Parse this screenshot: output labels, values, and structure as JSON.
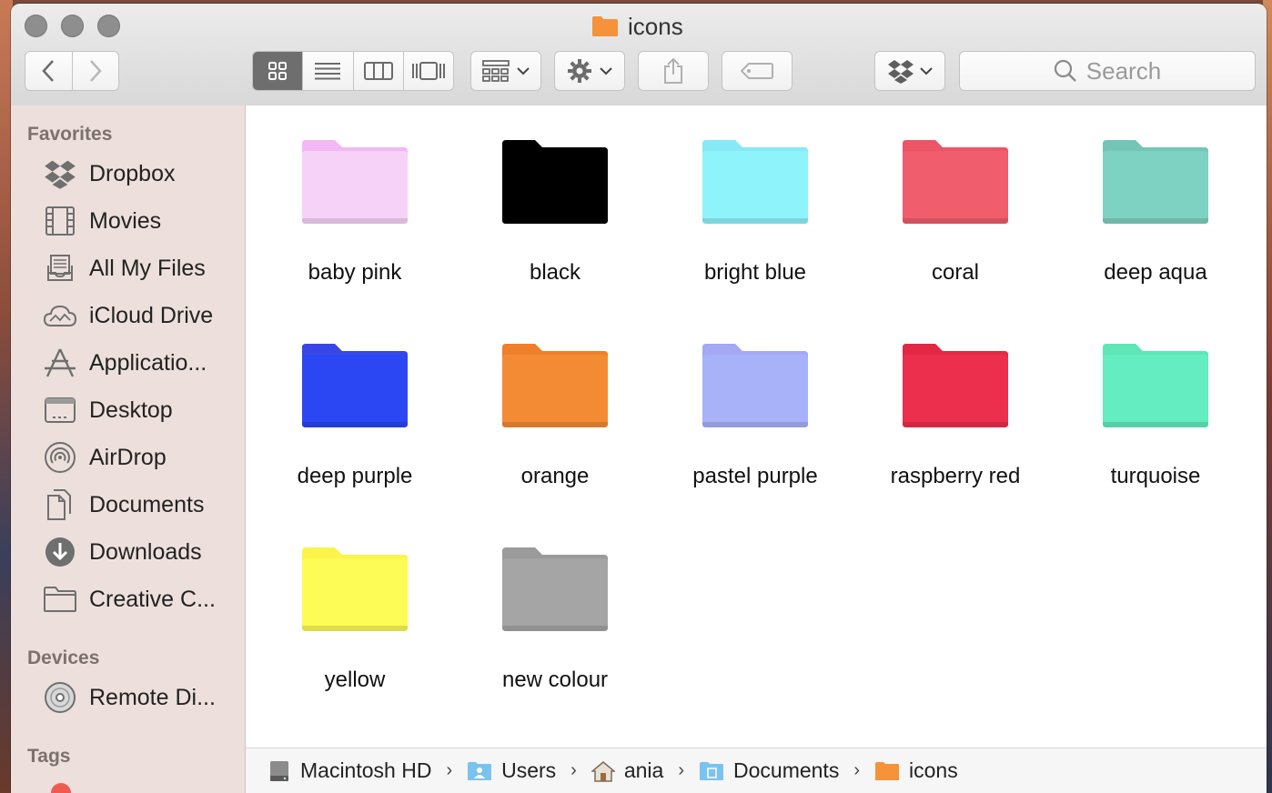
{
  "window": {
    "title": "icons"
  },
  "toolbar": {
    "search_placeholder": "Search"
  },
  "sidebar": {
    "favorites_header": "Favorites",
    "favorites": [
      {
        "label": "Dropbox",
        "icon": "dropbox-icon"
      },
      {
        "label": "Movies",
        "icon": "film-icon"
      },
      {
        "label": "All My Files",
        "icon": "all-files-icon"
      },
      {
        "label": "iCloud Drive",
        "icon": "cloud-icon"
      },
      {
        "label": "Applicatio...",
        "icon": "applications-icon"
      },
      {
        "label": "Desktop",
        "icon": "desktop-icon"
      },
      {
        "label": "AirDrop",
        "icon": "airdrop-icon"
      },
      {
        "label": "Documents",
        "icon": "documents-icon"
      },
      {
        "label": "Downloads",
        "icon": "download-icon"
      },
      {
        "label": "Creative C...",
        "icon": "folder-icon"
      }
    ],
    "devices_header": "Devices",
    "devices": [
      {
        "label": "Remote Di...",
        "icon": "disc-icon"
      }
    ],
    "tags_header": "Tags"
  },
  "folders": [
    {
      "name": "baby pink",
      "color": "#f7d2f8",
      "tab": "#f3b7f3"
    },
    {
      "name": "black",
      "color": "#000000",
      "tab": "#000000"
    },
    {
      "name": "bright blue",
      "color": "#8ff3fb",
      "tab": "#86e9f5"
    },
    {
      "name": "coral",
      "color": "#f05d6c",
      "tab": "#ec5565"
    },
    {
      "name": "deep aqua",
      "color": "#7ed2c2",
      "tab": "#74c5b6"
    },
    {
      "name": "deep purple",
      "color": "#2b47f3",
      "tab": "#3a45e8"
    },
    {
      "name": "orange",
      "color": "#f38b34",
      "tab": "#f07f2a"
    },
    {
      "name": "pastel purple",
      "color": "#a7b2f9",
      "tab": "#a5a8f5"
    },
    {
      "name": "raspberry red",
      "color": "#ec2f4d",
      "tab": "#e32845"
    },
    {
      "name": "turquoise",
      "color": "#64edc0",
      "tab": "#5ee6b6"
    },
    {
      "name": "yellow",
      "color": "#fdfb55",
      "tab": "#fbf44a"
    },
    {
      "name": "new colour",
      "color": "#a5a5a5",
      "tab": "#9b9b9b"
    }
  ],
  "pathbar": [
    {
      "label": "Macintosh HD",
      "icon": "hard-drive-icon"
    },
    {
      "label": "Users",
      "icon": "users-folder-icon"
    },
    {
      "label": "ania",
      "icon": "home-icon"
    },
    {
      "label": "Documents",
      "icon": "documents-folder-icon"
    },
    {
      "label": "icons",
      "icon": "orange-folder-icon"
    }
  ]
}
